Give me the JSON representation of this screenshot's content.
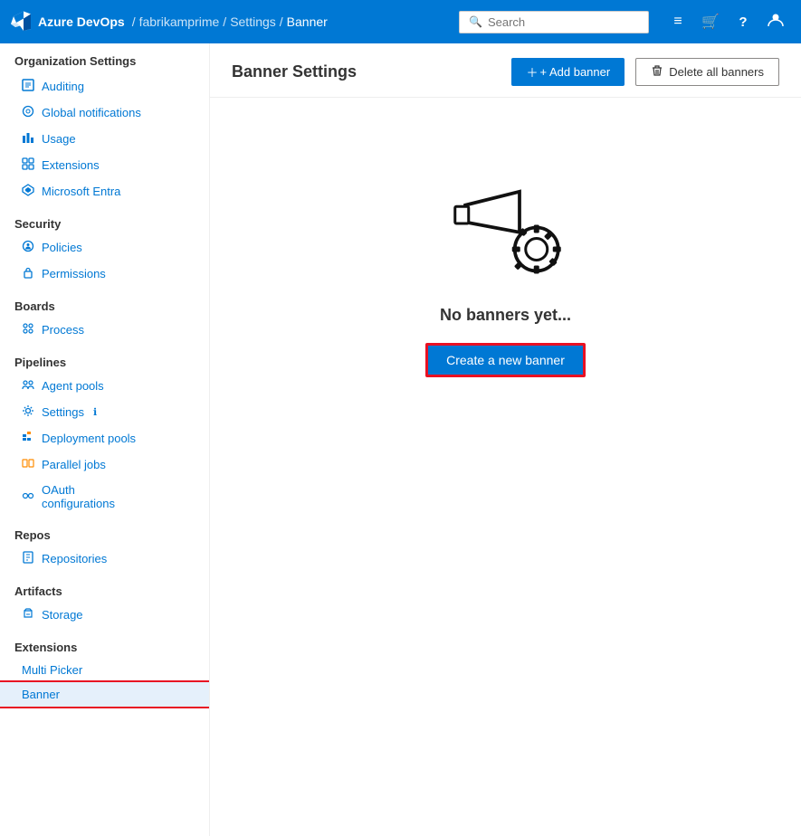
{
  "topbar": {
    "logo_text": "Azure DevOps",
    "breadcrumb": [
      {
        "label": "fabrikamprime",
        "sep": "/"
      },
      {
        "label": "Settings",
        "sep": "/"
      },
      {
        "label": "Banner",
        "sep": ""
      }
    ],
    "search_placeholder": "Search",
    "icons": [
      {
        "name": "list-icon",
        "glyph": "☰"
      },
      {
        "name": "basket-icon",
        "glyph": "🛒"
      },
      {
        "name": "help-icon",
        "glyph": "?"
      },
      {
        "name": "user-icon",
        "glyph": "👤"
      }
    ]
  },
  "sidebar": {
    "org_settings_label": "Organization Settings",
    "sections": [
      {
        "title": "",
        "items": [
          {
            "id": "auditing",
            "label": "Auditing",
            "icon": "⚙"
          },
          {
            "id": "global-notifications",
            "label": "Global notifications",
            "icon": "🔔"
          },
          {
            "id": "usage",
            "label": "Usage",
            "icon": "📊"
          },
          {
            "id": "extensions",
            "label": "Extensions",
            "icon": "🧩"
          },
          {
            "id": "microsoft-entra",
            "label": "Microsoft Entra",
            "icon": "◆"
          }
        ]
      },
      {
        "title": "Security",
        "items": [
          {
            "id": "policies",
            "label": "Policies",
            "icon": "🔒"
          },
          {
            "id": "permissions",
            "label": "Permissions",
            "icon": "🔑"
          }
        ]
      },
      {
        "title": "Boards",
        "items": [
          {
            "id": "process",
            "label": "Process",
            "icon": "⚙"
          }
        ]
      },
      {
        "title": "Pipelines",
        "items": [
          {
            "id": "agent-pools",
            "label": "Agent pools",
            "icon": "👥"
          },
          {
            "id": "settings",
            "label": "Settings",
            "icon": "⚙",
            "badge": "ℹ"
          },
          {
            "id": "deployment-pools",
            "label": "Deployment pools",
            "icon": "🔧"
          },
          {
            "id": "parallel-jobs",
            "label": "Parallel jobs",
            "icon": "▦"
          },
          {
            "id": "oauth-configurations",
            "label": "OAuth configurations",
            "icon": "🔗"
          }
        ]
      },
      {
        "title": "Repos",
        "items": [
          {
            "id": "repositories",
            "label": "Repositories",
            "icon": "🗄"
          }
        ]
      },
      {
        "title": "Artifacts",
        "items": [
          {
            "id": "storage",
            "label": "Storage",
            "icon": "📦"
          }
        ]
      },
      {
        "title": "Extensions",
        "items": [
          {
            "id": "multi-picker",
            "label": "Multi Picker",
            "icon": ""
          },
          {
            "id": "banner",
            "label": "Banner",
            "icon": "",
            "active": true
          }
        ]
      }
    ]
  },
  "content": {
    "title": "Banner Settings",
    "add_banner_label": "+ Add banner",
    "delete_all_label": "Delete all banners",
    "empty_title": "No banners yet...",
    "create_banner_label": "Create a new banner"
  }
}
